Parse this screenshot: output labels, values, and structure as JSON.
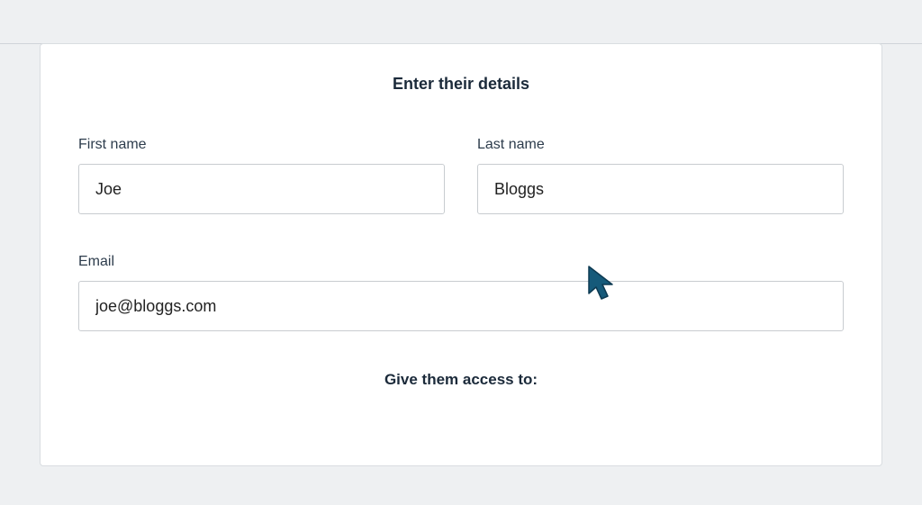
{
  "form": {
    "heading": "Enter their details",
    "first_name": {
      "label": "First name",
      "value": "Joe"
    },
    "last_name": {
      "label": "Last name",
      "value": "Bloggs"
    },
    "email": {
      "label": "Email",
      "value": "joe@bloggs.com"
    },
    "access_heading": "Give them access to:"
  }
}
